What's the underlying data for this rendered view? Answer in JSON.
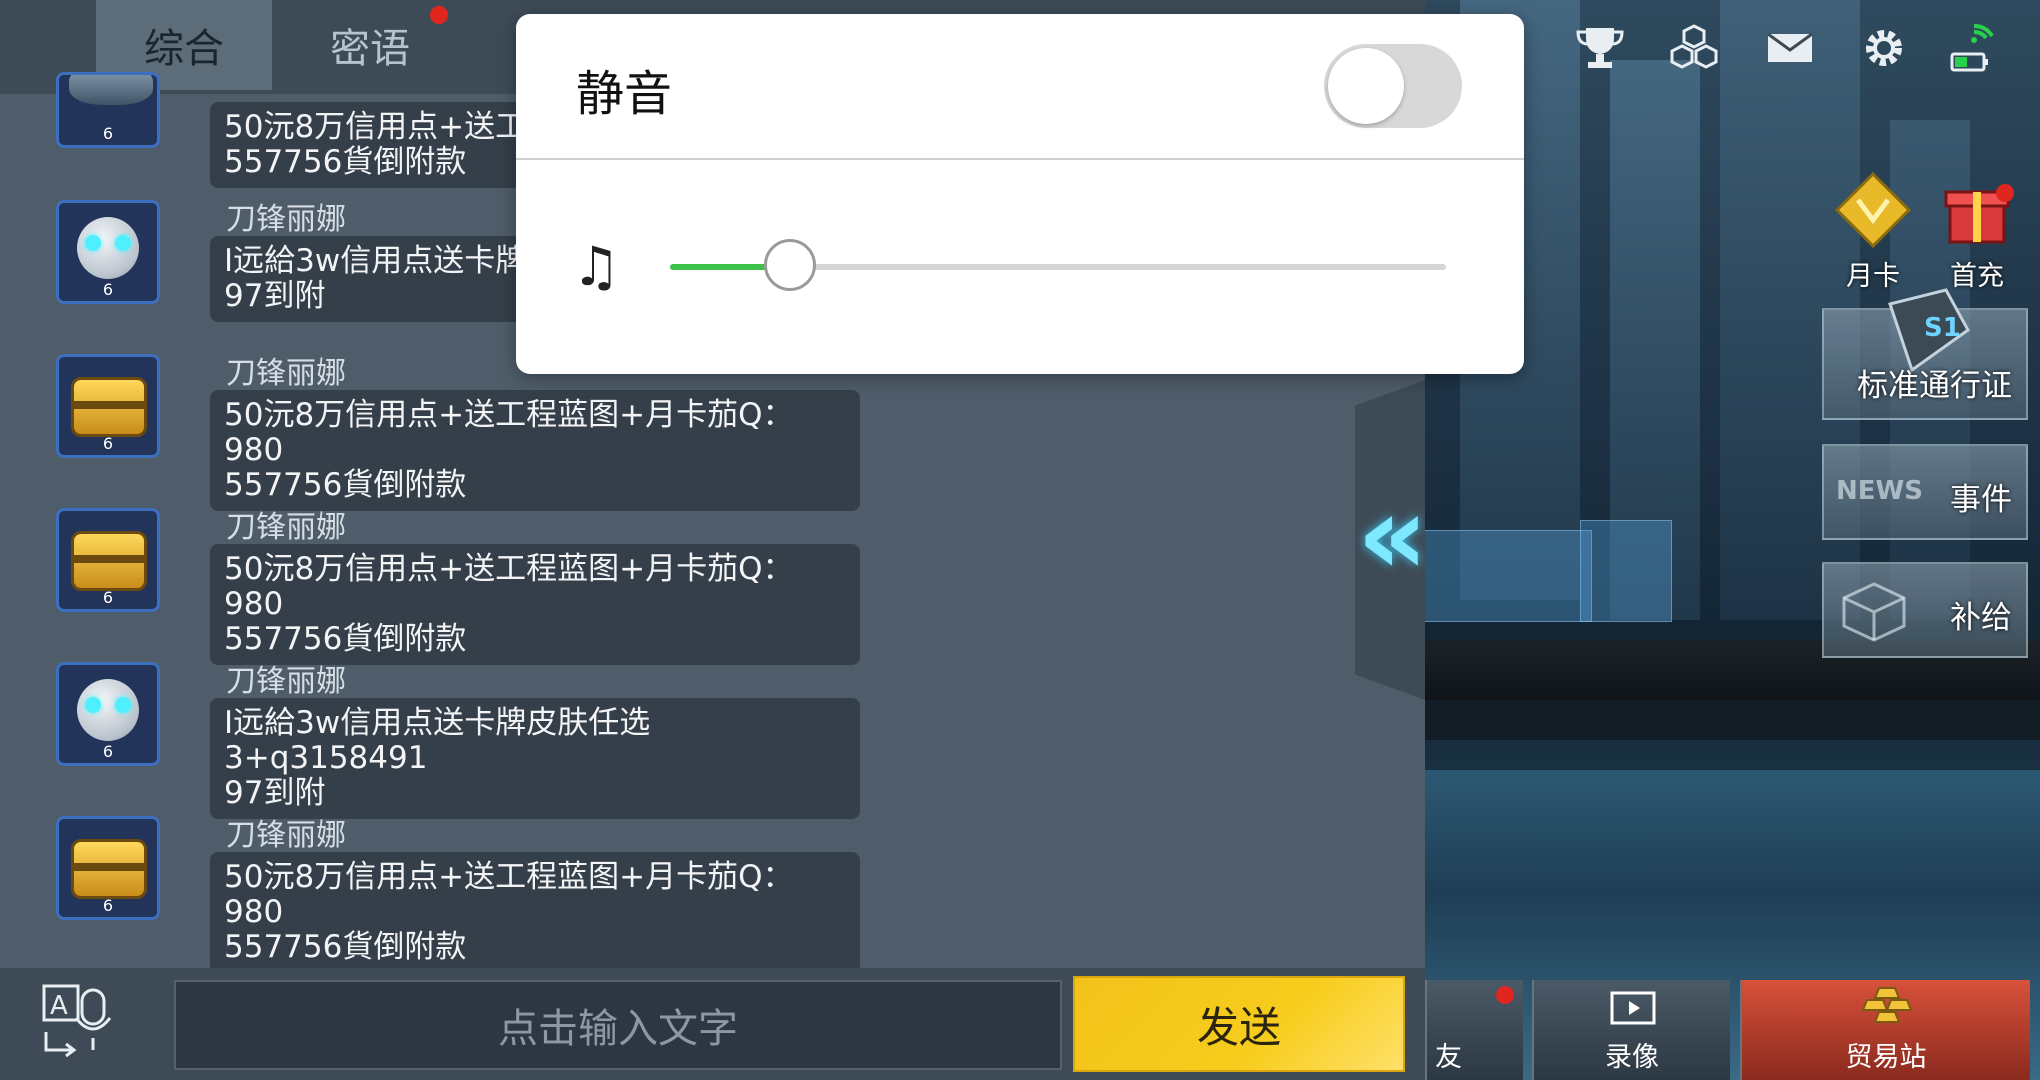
{
  "chat": {
    "tabs": [
      {
        "label": "综合",
        "active": true
      },
      {
        "label": "密语",
        "has_notification": true
      }
    ],
    "messages": [
      {
        "avatar": "ship",
        "level": "6",
        "sender": "",
        "text_line1": "50沅8万信用点+送工",
        "text_line2": "557756貨倒附款"
      },
      {
        "avatar": "robot",
        "level": "6",
        "sender": "刀锋丽娜",
        "text_line1": "I远給3w信用点送卡牌",
        "text_line2": "97到附"
      },
      {
        "avatar": "chest",
        "level": "6",
        "sender": "刀锋丽娜",
        "text_line1": "50沅8万信用点+送工程蓝图+月卡茄Q：980",
        "text_line2": "557756貨倒附款"
      },
      {
        "avatar": "chest",
        "level": "6",
        "sender": "刀锋丽娜",
        "text_line1": "50沅8万信用点+送工程蓝图+月卡茄Q：980",
        "text_line2": "557756貨倒附款"
      },
      {
        "avatar": "robot",
        "level": "6",
        "sender": "刀锋丽娜",
        "text_line1": "I远給3w信用点送卡牌皮肤任选3+q3158491",
        "text_line2": "97到附"
      },
      {
        "avatar": "chest",
        "level": "6",
        "sender": "刀锋丽娜",
        "text_line1": "50沅8万信用点+送工程蓝图+月卡茄Q：980",
        "text_line2": "557756貨倒附款"
      }
    ],
    "input_placeholder": "点击输入文字",
    "send_label": "发送"
  },
  "popup": {
    "mute_label": "静音",
    "mute_on": false,
    "volume_fraction": 0.155
  },
  "top_icons": [
    "trophy-icon",
    "cubes-icon",
    "mail-icon",
    "settings-icon",
    "battery-signal-icon"
  ],
  "side_packs": [
    {
      "label": "月卡"
    },
    {
      "label": "首充"
    }
  ],
  "side_buttons": [
    {
      "label": "标准通行证",
      "badge": "S1"
    },
    {
      "label": "事件",
      "deco": "NEWS"
    },
    {
      "label": "补给"
    }
  ],
  "bottom_nav": [
    {
      "label": "友",
      "has_notification": true
    },
    {
      "label": "录像"
    },
    {
      "label": "贸易站"
    }
  ],
  "colors": {
    "accent_green": "#3cc14b",
    "send_yellow": "#f2c21a",
    "notification_red": "#e0261f"
  }
}
